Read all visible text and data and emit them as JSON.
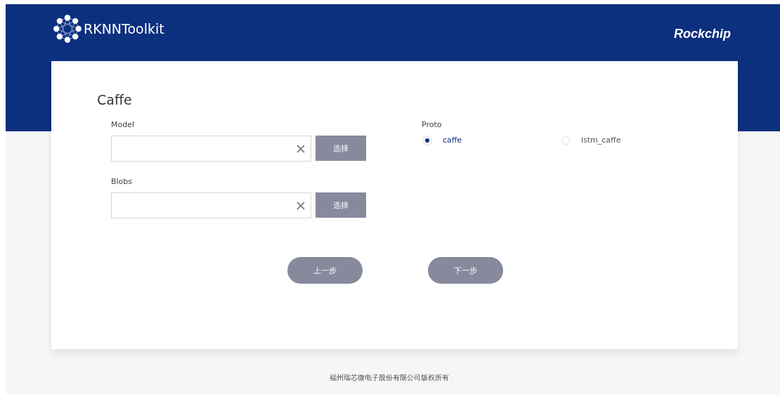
{
  "header": {
    "app_name": "RKNNToolkit",
    "brand": "Rockchip"
  },
  "form": {
    "title": "Caffe",
    "files": [
      {
        "label": "Model",
        "button": "选择"
      },
      {
        "label": "Blobs",
        "button": "选择"
      }
    ],
    "proto": {
      "label": "Proto",
      "options": [
        {
          "label": "caffe",
          "selected": true
        },
        {
          "label": "lstm_caffe",
          "selected": false
        }
      ]
    },
    "buttons": [
      "上一步",
      "下一步"
    ]
  },
  "footer": "福州瑞芯微电子股份有限公司版权所有"
}
